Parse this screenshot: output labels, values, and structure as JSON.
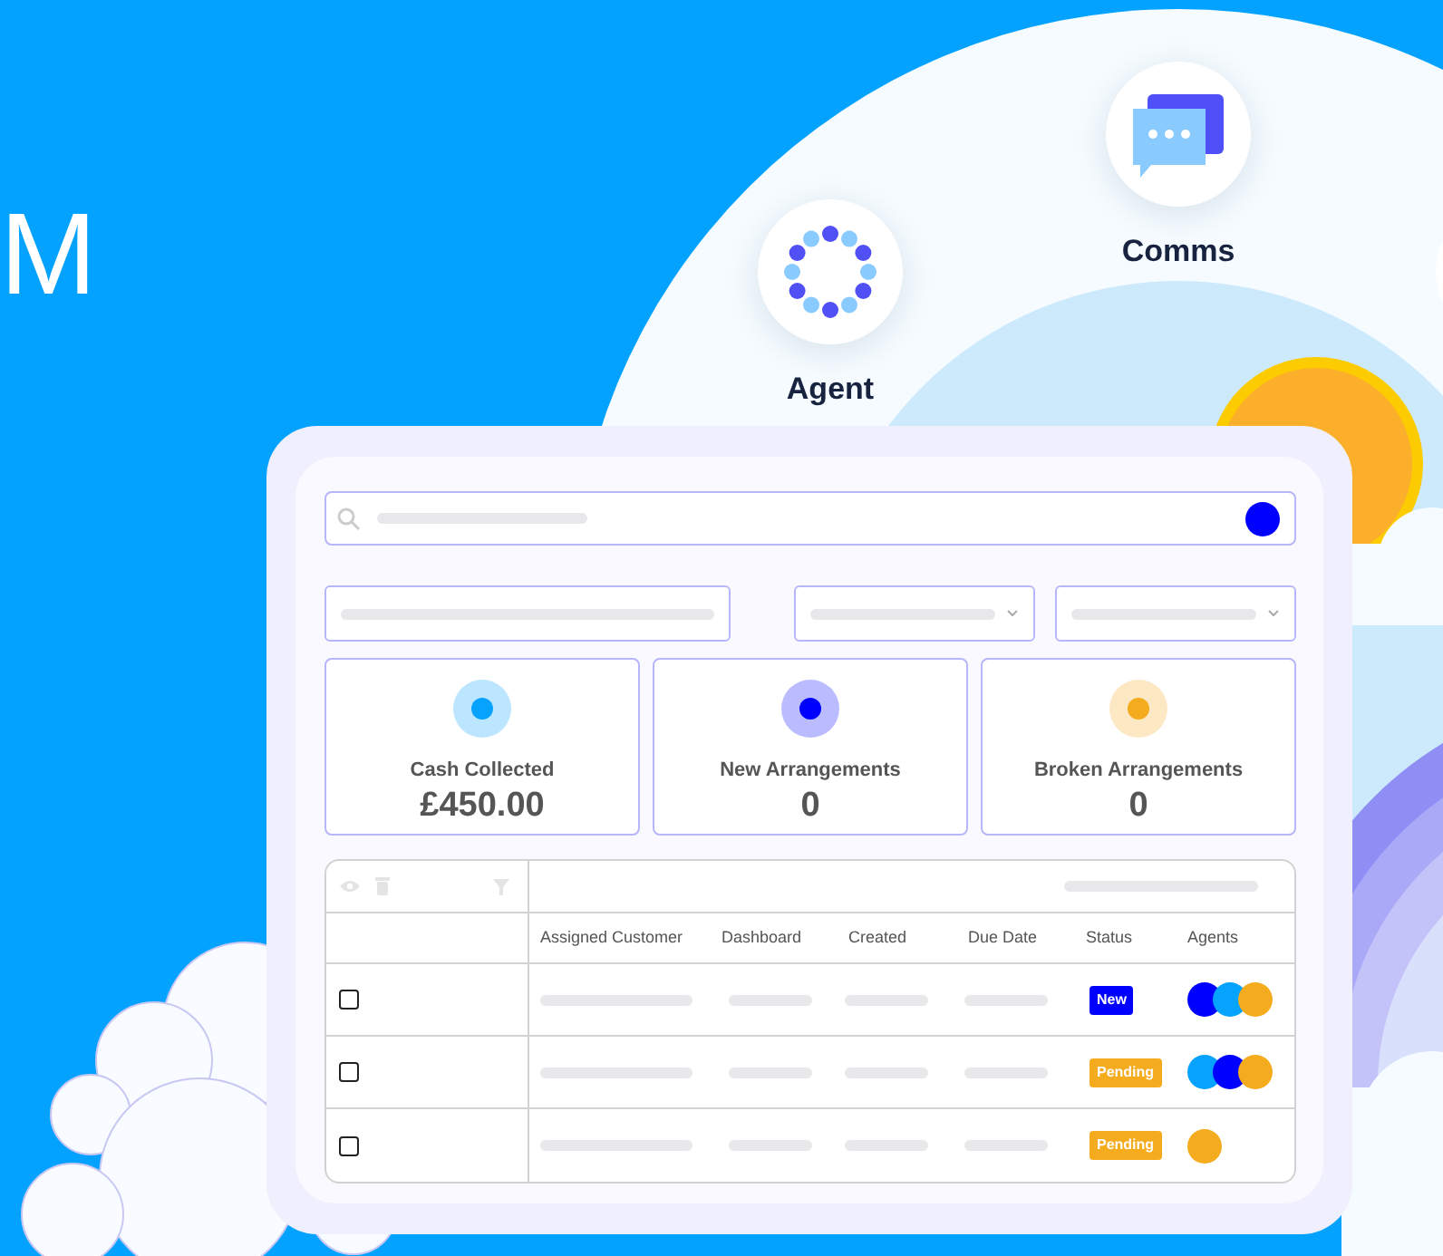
{
  "hero": {
    "heading_fragment": "M"
  },
  "features": [
    {
      "label": "Agent",
      "kind": "dots"
    },
    {
      "label": "Comms",
      "kind": "chat"
    }
  ],
  "dashboard": {
    "stats": [
      {
        "label": "Cash Collected",
        "value": "£450.00",
        "color": "#05a2fe"
      },
      {
        "label": "New Arrangements",
        "value": "0",
        "color": "#0000ff"
      },
      {
        "label": "Broken Arrangements",
        "value": "0",
        "color": "#f5ab1e"
      }
    ],
    "table": {
      "columns": [
        "Assigned Customer",
        "Dashboard",
        "Created",
        "Due Date",
        "Status",
        "Agents"
      ],
      "rows": [
        {
          "checked": false,
          "status": {
            "label": "New",
            "color": "#0000ff"
          },
          "agents": [
            {
              "color": "#0000ff"
            },
            {
              "color": "#05a2fe"
            },
            {
              "color": "#f5ab1e"
            }
          ]
        },
        {
          "checked": false,
          "status": {
            "label": "Pending",
            "color": "#f5ab1e"
          },
          "agents": [
            {
              "color": "#05a2fe"
            },
            {
              "color": "#0000ff"
            },
            {
              "color": "#f5ab1e"
            }
          ]
        },
        {
          "checked": false,
          "status": {
            "label": "Pending",
            "color": "#f5ab1e"
          },
          "agents": [
            {
              "color": "#f5ab1e"
            }
          ]
        }
      ]
    }
  }
}
